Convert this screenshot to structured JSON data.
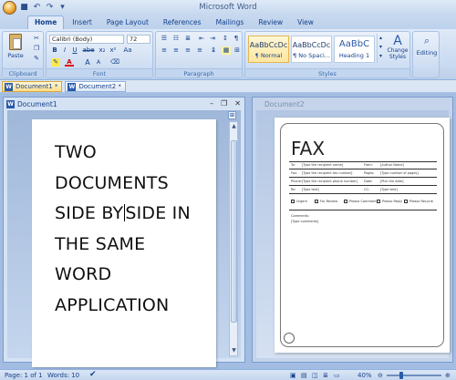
{
  "window": {
    "title": "Microsoft Word"
  },
  "qat": {
    "icons": [
      "office-button",
      "save-icon",
      "undo-icon",
      "redo-icon"
    ]
  },
  "tabs": [
    {
      "label": "Home",
      "active": true
    },
    {
      "label": "Insert"
    },
    {
      "label": "Page Layout"
    },
    {
      "label": "References"
    },
    {
      "label": "Mailings"
    },
    {
      "label": "Review"
    },
    {
      "label": "View"
    }
  ],
  "ribbon": {
    "clipboard": {
      "label": "Clipboard",
      "paste": "Paste"
    },
    "font": {
      "label": "Font",
      "font_name": "Calibri (Body)",
      "font_size": "72",
      "bold": "B",
      "italic": "I",
      "underline": "U",
      "strike": "abe",
      "sub": "x₂",
      "sup": "x²",
      "grow": "A",
      "shrink": "A",
      "color": "A",
      "case": "Aa"
    },
    "paragraph": {
      "label": "Paragraph",
      "pilcrow": "¶"
    },
    "styles": {
      "label": "Styles",
      "items": [
        {
          "sample": "AaBbCcDc",
          "name": "¶ Normal",
          "selected": true
        },
        {
          "sample": "AaBbCcDc",
          "name": "¶ No Spaci...",
          "selected": false
        },
        {
          "sample": "AaBbC",
          "name": "Heading 1",
          "selected": false
        }
      ],
      "change_styles": "Change Styles"
    },
    "editing": {
      "label": "Editing"
    }
  },
  "docbar": {
    "items": [
      {
        "label": "Document1 *",
        "active": true
      },
      {
        "label": "Document2 *",
        "active": false
      }
    ]
  },
  "doc1": {
    "title": "Document1",
    "lines": [
      "TWO",
      "DOCUMENTS",
      "SIDE BY",
      "SIDE IN",
      "THE SAME",
      "WORD",
      "APPLICATION"
    ]
  },
  "doc2": {
    "title": "Document2",
    "fax_title": "FAX",
    "rows": [
      [
        "To:",
        "[Type the recipient name]",
        "From:",
        "[Author Name]"
      ],
      [
        "Fax:",
        "[Type the recipient fax number]",
        "Pages:",
        "[Type number of pages]"
      ],
      [
        "Phone:",
        "[Type the recipient phone number]",
        "Date:",
        "[Pick the date]"
      ],
      [
        "Re:",
        "[Type text]",
        "CC:",
        "[Type text]"
      ]
    ],
    "checks": [
      "Urgent",
      "For Review",
      "Please Comment",
      "Please Reply",
      "Please Recycle"
    ],
    "comments_label": "Comments:",
    "comments": "[Type comments]"
  },
  "status": {
    "page": "Page: 1 of 1",
    "words": "Words: 10",
    "zoom": "40%"
  }
}
